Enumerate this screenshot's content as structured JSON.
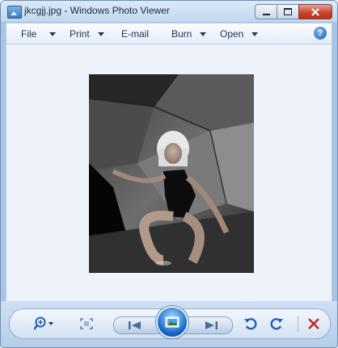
{
  "window": {
    "title": "jkcgjj.jpg - Windows Photo Viewer"
  },
  "menu": {
    "items": [
      {
        "label": "File",
        "has_dropdown": true
      },
      {
        "label": "Print",
        "has_dropdown": true
      },
      {
        "label": "E-mail",
        "has_dropdown": false
      },
      {
        "label": "Burn",
        "has_dropdown": true
      },
      {
        "label": "Open",
        "has_dropdown": true
      }
    ],
    "help_glyph": "?"
  },
  "toolbar": {
    "icons": [
      "zoom-icon",
      "actual-size-icon",
      "previous-icon",
      "slideshow-icon",
      "next-icon",
      "rotate-left-icon",
      "rotate-right-icon",
      "delete-icon"
    ]
  },
  "colors": {
    "delete": "#c62828",
    "rotate": "#1f5eb6",
    "accent": "#1767c8"
  }
}
